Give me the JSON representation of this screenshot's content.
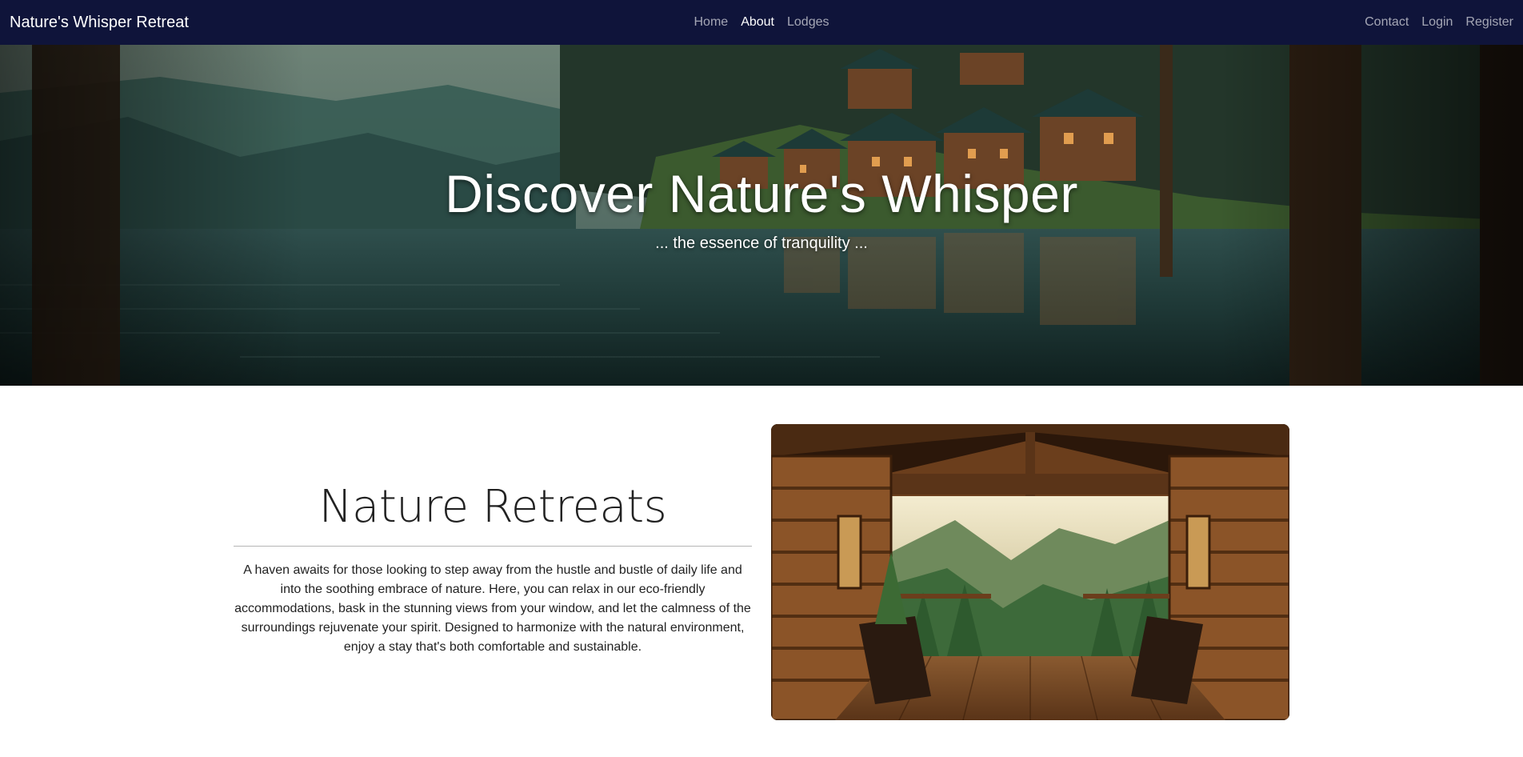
{
  "navbar": {
    "brand": "Nature's Whisper Retreat",
    "center_links": [
      {
        "label": "Home",
        "active": false
      },
      {
        "label": "About",
        "active": true
      },
      {
        "label": "Lodges",
        "active": false
      }
    ],
    "right_links": [
      {
        "label": "Contact"
      },
      {
        "label": "Login"
      },
      {
        "label": "Register"
      }
    ],
    "background": "#0f143a"
  },
  "hero": {
    "title": "Discover Nature's Whisper",
    "subtitle": "... the essence of tranquility ..."
  },
  "retreat": {
    "heading": "Nature Retreats",
    "body": "A haven awaits for those looking to step away from the hustle and bustle of daily life and into the soothing embrace of nature. Here, you can relax in our eco-friendly accommodations, bask in the stunning views from your window, and let the calmness of the surroundings rejuvenate your spirit. Designed to harmonize with the natural environment, enjoy a stay that's both comfortable and sustainable."
  }
}
